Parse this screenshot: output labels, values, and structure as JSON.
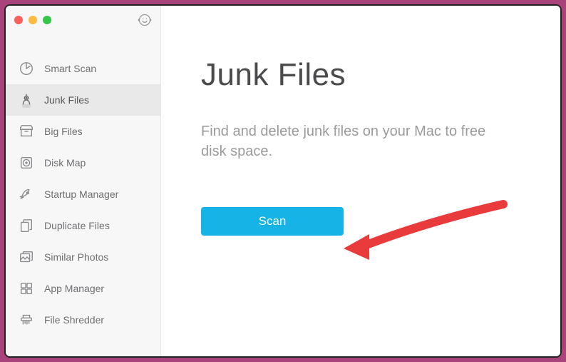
{
  "sidebar": {
    "items": [
      {
        "label": "Smart Scan"
      },
      {
        "label": "Junk Files"
      },
      {
        "label": "Big Files"
      },
      {
        "label": "Disk Map"
      },
      {
        "label": "Startup Manager"
      },
      {
        "label": "Duplicate Files"
      },
      {
        "label": "Similar Photos"
      },
      {
        "label": "App Manager"
      },
      {
        "label": "File Shredder"
      }
    ],
    "selected_index": 1
  },
  "content": {
    "title": "Junk Files",
    "subtitle": "Find and delete junk files on your Mac to free disk space.",
    "scan_label": "Scan"
  }
}
